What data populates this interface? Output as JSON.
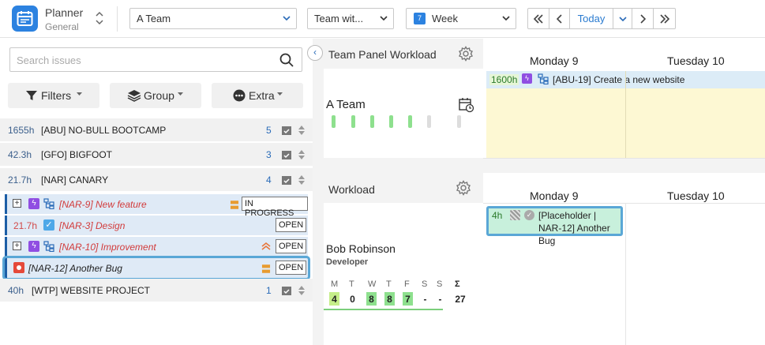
{
  "app": {
    "name": "Planner",
    "subtitle": "General"
  },
  "toolbar": {
    "team_select": "A Team",
    "team_with_select": "Team wit...",
    "period_select": "Week",
    "today_label": "Today"
  },
  "left_panel": {
    "search_placeholder": "Search issues",
    "filters_label": "Filters",
    "group_label": "Group",
    "extra_label": "Extra",
    "groups": [
      {
        "hours": "1655h",
        "name": "[ABU] NO-BULL BOOTCAMP",
        "count": "5"
      },
      {
        "hours": "42.3h",
        "name": "[GFO] BIGFOOT",
        "count": "3"
      },
      {
        "hours": "21.7h",
        "name": "[NAR] CANARY",
        "count": "4"
      },
      {
        "hours": "40h",
        "name": "[WTP] WEBSITE PROJECT",
        "count": "1"
      }
    ],
    "issues": [
      {
        "title": "[NAR-9] New feature",
        "status": "IN PROGRESS",
        "hours": ""
      },
      {
        "title": "[NAR-3] Design",
        "status": "OPEN",
        "hours": "21.7h"
      },
      {
        "title": "[NAR-10] Improvement",
        "status": "OPEN",
        "hours": ""
      },
      {
        "title": "[NAR-12] Another Bug",
        "status": "OPEN",
        "hours": ""
      }
    ]
  },
  "team_panel": {
    "title": "Team Panel Workload",
    "team_name": "A Team",
    "day1": "Monday 9",
    "day2": "Tuesday 10",
    "event": {
      "hours": "1600h",
      "title": "[ABU-19] Create a new website"
    }
  },
  "workload_panel": {
    "title": "Workload",
    "day1": "Monday 9",
    "day2": "Tuesday 10",
    "user": {
      "name": "Bob Robinson",
      "role": "Developer"
    },
    "week_letters": [
      "M",
      "T",
      "W",
      "T",
      "F",
      "S",
      "S",
      "Σ"
    ],
    "week_values": [
      "4",
      "0",
      "8",
      "8",
      "7",
      "-",
      "-",
      "27"
    ],
    "card": {
      "hours": "4h",
      "title": "[Placeholder | NAR-12] Another Bug"
    }
  },
  "colors": {
    "accent": "#2c82e0",
    "issue_bg": "#dfeaf6",
    "issue_border": "#1c5ea6",
    "event_bg": "#dcecf7",
    "day_bg": "#fdf8d3",
    "card_bg": "#c8f0dc",
    "bar_green": "#8ee08e"
  }
}
